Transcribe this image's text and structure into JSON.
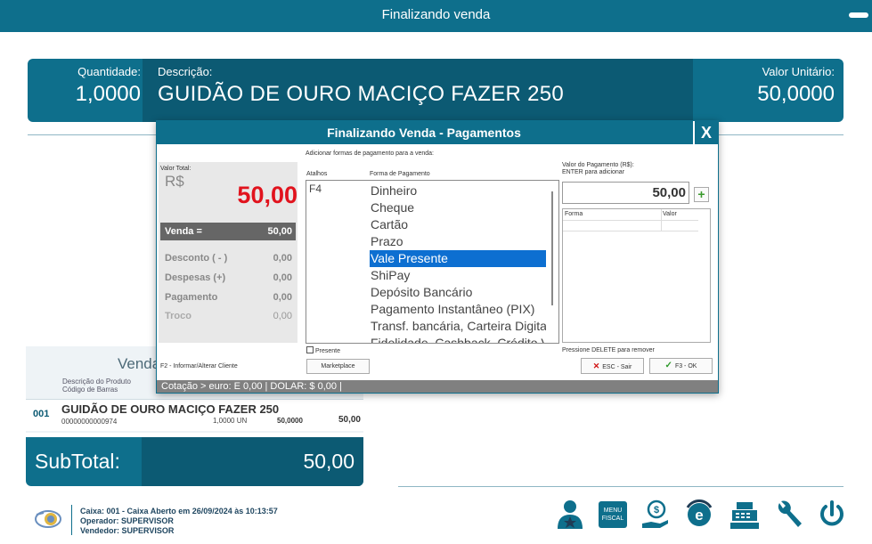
{
  "window": {
    "title": "Finalizando venda"
  },
  "item": {
    "qty_label": "Quantidade:",
    "qty_value": "1,0000",
    "desc_label": "Descrição:",
    "desc_value": "GUIDÃO DE OURO MACIÇO FAZER 250",
    "unit_label": "Valor Unitário:",
    "unit_value": "50,0000"
  },
  "sale": {
    "heading": "Venda",
    "col_desc": "Descrição do Produto",
    "col_barcode": "Código de Barras",
    "row": {
      "code": "001",
      "description": "GUIDÃO DE OURO MACIÇO FAZER 250",
      "barcode": "00000000000974",
      "qty": "1,0000  UN",
      "unit_price": "50,0000",
      "total": "50,00"
    }
  },
  "subtotal": {
    "label": "SubTotal:",
    "value": "50,00"
  },
  "footer": {
    "caixa": "Caixa: 001 - Caixa Aberto em 26/09/2024 às 10:13:57",
    "operador": "Operador: SUPERVISOR",
    "vendedor": "Vendedor: SUPERVISOR"
  },
  "toolbar_icons": [
    "user-star-icon",
    "menu-fiscal-icon",
    "money-hand-icon",
    "e-document-icon",
    "cash-register-icon",
    "wrench-icon",
    "power-icon"
  ],
  "menu_fiscal_text": "MENU FISCAL",
  "modal": {
    "title": "Finalizando Venda - Pagamentos",
    "close": "X",
    "valor_total_label": "Valor Total:",
    "currency": "R$",
    "total": "50,00",
    "venda_label": "Venda =",
    "venda_value": "50,00",
    "desconto_label": "Desconto ( - )",
    "desconto_value": "0,00",
    "despesas_label": "Despesas (+)",
    "despesas_value": "0,00",
    "pagamento_label": "Pagamento",
    "pagamento_value": "0,00",
    "troco_label": "Troco",
    "troco_value": "0,00",
    "f2_hint": "F2 - Informar/Alterar Cliente",
    "add_hint": "Adicionar formas de pagamento para a venda:",
    "atalhos_label": "Atalhos",
    "forma_label": "Forma de Pagamento",
    "shortcut": "F4",
    "payment_methods": [
      "Dinheiro",
      "Cheque",
      "Cartão",
      "Prazo",
      "Vale Presente",
      "ShiPay",
      "Depósito Bancário",
      "Pagamento Instantâneo (PIX)",
      "Transf. bancária, Carteira Digital",
      "Fidelidade, Cashback, Crédito Virtual"
    ],
    "selected_method": "Vale Presente",
    "presente_label": "Presente",
    "marketplace_label": "Marketplace",
    "valor_pagamento_label": "Valor do Pagamento (R$):",
    "enter_hint": "ENTER para adicionar",
    "payment_input": "50,00",
    "grid_forma": "Forma",
    "grid_valor": "Valor",
    "delete_hint": "Pressione DELETE para remover",
    "esc_label": "ESC - Sair",
    "ok_label": "F3 - OK",
    "cotacao": "Cotação  >  euro:  E  0,00  |  DOLAR:  $  0,00  |"
  },
  "colors": {
    "primary": "#0e6f8c",
    "primary_dark": "#0c5a73",
    "total_red": "#e1131d",
    "selection": "#0d6fd1"
  }
}
